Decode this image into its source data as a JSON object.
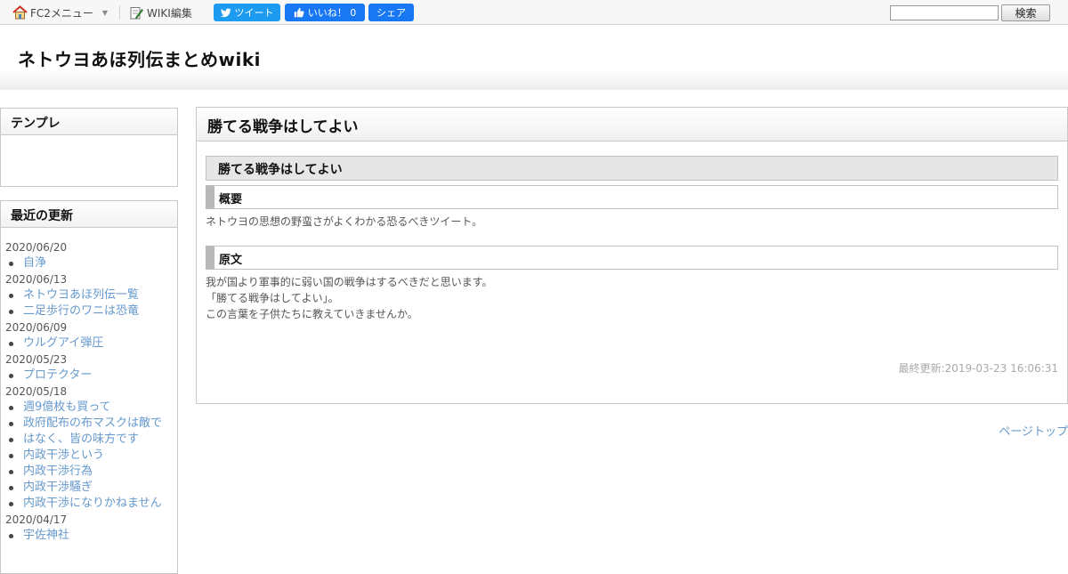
{
  "toolbar": {
    "fc2_menu_label": "FC2メニュー",
    "wiki_edit_label": "WIKI編集",
    "tweet_label": "ツイート",
    "like_label": "いいね！ 0",
    "share_label": "シェア",
    "search_value": "",
    "search_button_label": "検索"
  },
  "header": {
    "site_title": "ネトウヨあほ列伝まとめwiki"
  },
  "sidebar": {
    "template_title": "テンプレ",
    "recent_title": "最近の更新",
    "recent_groups": [
      {
        "date": "2020/06/20",
        "links": [
          "自浄"
        ]
      },
      {
        "date": "2020/06/13",
        "links": [
          "ネトウヨあほ列伝一覧",
          "二足歩行のワニは恐竜"
        ]
      },
      {
        "date": "2020/06/09",
        "links": [
          "ウルグアイ弾圧"
        ]
      },
      {
        "date": "2020/05/23",
        "links": [
          "プロテクター"
        ]
      },
      {
        "date": "2020/05/18",
        "links": [
          "週9億枚も買って",
          "政府配布の布マスクは敵で",
          "はなく、皆の味方です",
          "内政干渉という",
          "内政干渉行為",
          "内政干渉騒ぎ",
          "内政干渉になりかねません"
        ]
      },
      {
        "date": "2020/04/17",
        "links": [
          "宇佐神社"
        ]
      }
    ]
  },
  "main": {
    "page_title": "勝てる戦争はしてよい",
    "section_title": "勝てる戦争はしてよい",
    "summary_heading": "概要",
    "summary_text": "ネトウヨの思想の野蛮さがよくわかる恐るべきツイート。",
    "original_heading": "原文",
    "original_lines": [
      "我が国より軍事的に弱い国の戦争はするべきだと思います。",
      "「勝てる戦争はしてよい」。",
      "この言葉を子供たちに教えていきませんか。"
    ],
    "last_updated": "最終更新:2019-03-23 16:06:31",
    "page_top_label": "ページトップ"
  },
  "colors": {
    "link": "#6699cc",
    "tweet": "#1d9bf0",
    "facebook": "#1877f2"
  },
  "icons": [
    "home-icon",
    "caret-down-icon",
    "edit-icon",
    "twitter-bird-icon",
    "thumbs-up-icon"
  ]
}
